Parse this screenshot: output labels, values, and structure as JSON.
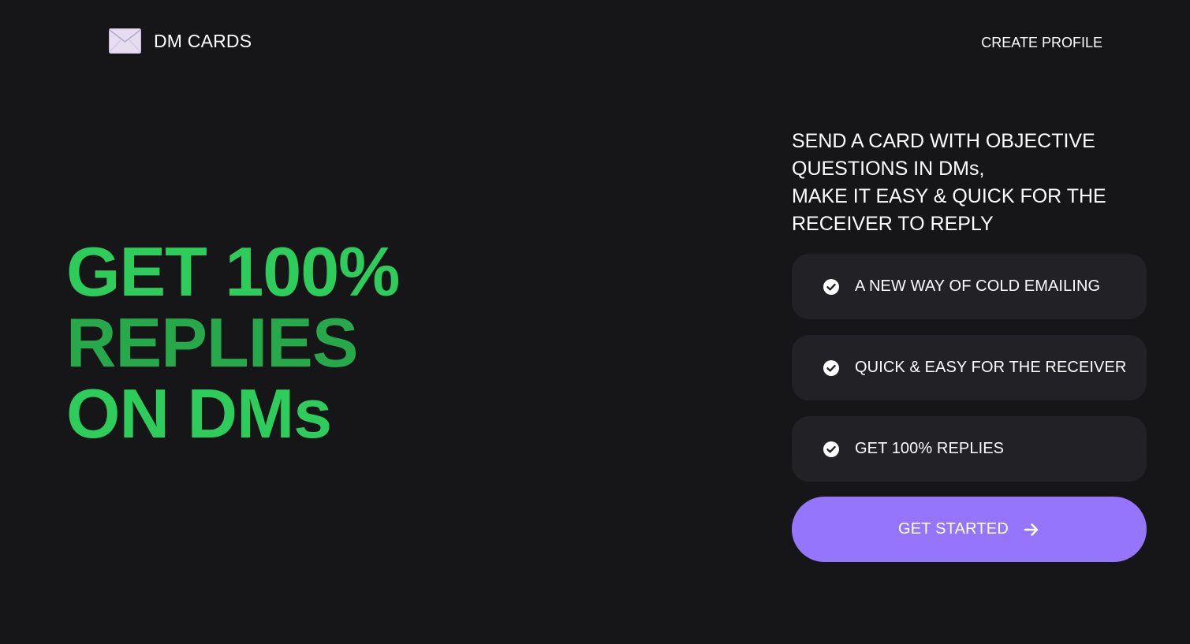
{
  "header": {
    "brand_icon": "envelope-icon",
    "brand_name": "DM CARDS",
    "nav_create_profile": "CREATE PROFILE"
  },
  "hero": {
    "line1": "GET 100%",
    "line2": "REPLIES",
    "line3": "ON DMs",
    "colors": {
      "primary": "#2ecc5b",
      "secondary": "#27a84a"
    }
  },
  "pitch": {
    "line1": "SEND A CARD WITH OBJECTIVE",
    "line2": "QUESTIONS IN DMs,",
    "line3": "MAKE IT EASY & QUICK FOR THE",
    "line4": "RECEIVER TO REPLY"
  },
  "features": [
    {
      "icon": "check-circle-icon",
      "label": "A NEW WAY OF COLD EMAILING"
    },
    {
      "icon": "check-circle-icon",
      "label": "QUICK & EASY FOR THE RECEIVER"
    },
    {
      "icon": "check-circle-icon",
      "label": "GET 100% REPLIES"
    }
  ],
  "cta": {
    "label": "GET STARTED",
    "icon": "arrow-right-icon",
    "color": "#9575fb"
  },
  "theme": {
    "background": "#161517",
    "card": "#222226"
  }
}
